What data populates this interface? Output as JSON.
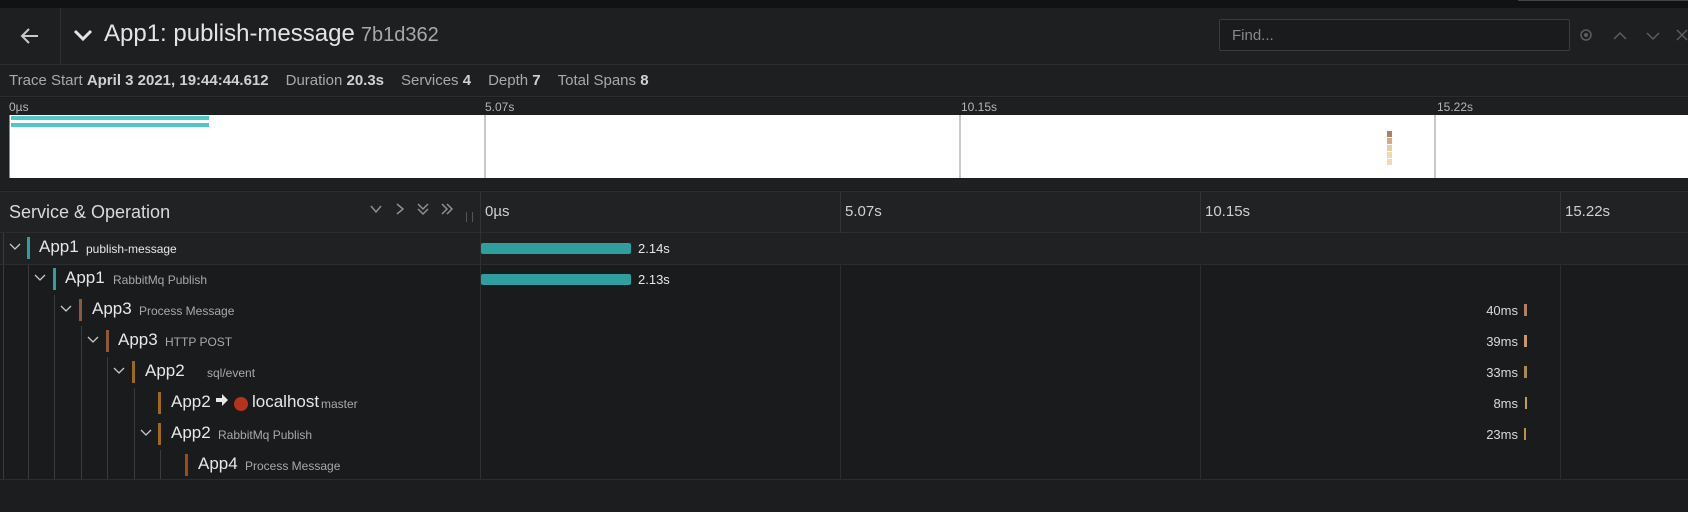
{
  "header": {
    "back_icon": "arrow-left-icon",
    "collapse_icon": "chevron-down-icon",
    "title": "App1: publish-message",
    "trace_id": "7b1d362",
    "find_placeholder": "Find...",
    "find_value": ""
  },
  "meta": {
    "trace_start_label": "Trace Start",
    "trace_start_value": "April 3 2021, 19:44:44.612",
    "duration_label": "Duration",
    "duration_value": "20.3s",
    "services_label": "Services",
    "services_value": "4",
    "depth_label": "Depth",
    "depth_value": "7",
    "total_spans_label": "Total Spans",
    "total_spans_value": "8"
  },
  "minimap": {
    "ticks": [
      "0µs",
      "5.07s",
      "10.15s",
      "15.22s"
    ]
  },
  "table": {
    "service_operation_label": "Service & Operation",
    "ticks": [
      "0µs",
      "5.07s",
      "10.15s",
      "15.22s"
    ]
  },
  "spans": [
    {
      "service": "App1",
      "operation": "publish-message",
      "duration": "2.14s",
      "color": "#2e9e9e",
      "start_fraction": 0.0,
      "duration_fraction": 0.105
    },
    {
      "service": "App1",
      "operation": "RabbitMq Publish",
      "duration": "2.13s",
      "color": "#2e9e9e",
      "start_fraction": 0.0,
      "duration_fraction": 0.105
    },
    {
      "service": "App3",
      "operation": "Process Message",
      "duration": "40ms",
      "color": "#8a5a3a",
      "start_fraction": 0.9,
      "duration_fraction": 0.002
    },
    {
      "service": "App3",
      "operation": "HTTP POST",
      "duration": "39ms",
      "color": "#8a5a3a",
      "start_fraction": 0.9,
      "duration_fraction": 0.002
    },
    {
      "service": "App2",
      "operation": "sql/event",
      "duration": "33ms",
      "color": "#9a6a1e",
      "start_fraction": 0.9,
      "duration_fraction": 0.0016
    },
    {
      "service": "App2",
      "peer": "localhost",
      "operation": "master",
      "duration": "8ms",
      "color": "#9a6a1e",
      "start_fraction": 0.9,
      "duration_fraction": 0.0004
    },
    {
      "service": "App2",
      "operation": "RabbitMq Publish",
      "duration": "23ms",
      "color": "#9a6a1e",
      "start_fraction": 0.9,
      "duration_fraction": 0.0011
    },
    {
      "service": "App4",
      "operation": "Process Message",
      "duration": "",
      "color": "#a04a1a",
      "start_fraction": 0.9,
      "duration_fraction": 0.0
    }
  ],
  "colors": {
    "app1": "#2e9e9e",
    "app3": "#8a5a3a",
    "app2": "#9a6a1e",
    "app4": "#a04a1a",
    "peer_db": "#b5321e"
  }
}
